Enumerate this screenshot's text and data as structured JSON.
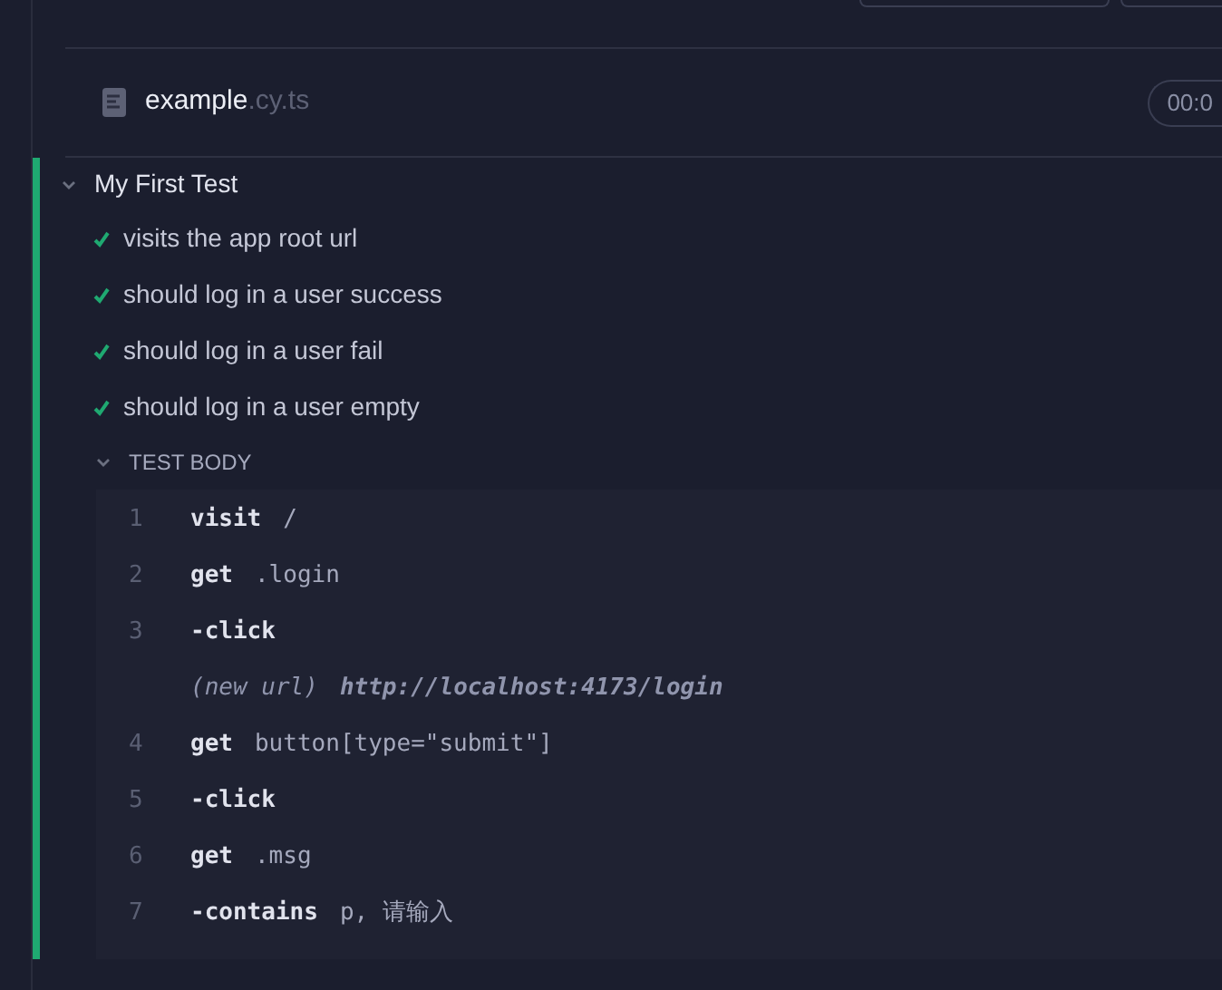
{
  "spec": {
    "name": "example",
    "extension": ".cy.ts",
    "duration": "00:0"
  },
  "suite": {
    "title": "My First Test",
    "expanded": true,
    "tests": [
      {
        "title": "visits the app root url",
        "passed": true
      },
      {
        "title": "should log in a user success",
        "passed": true
      },
      {
        "title": "should log in a user fail",
        "passed": true
      },
      {
        "title": "should log in a user empty",
        "passed": true
      }
    ],
    "test_body": {
      "label": "TEST BODY",
      "expanded": true,
      "commands": [
        {
          "kind": "command",
          "number": "1",
          "name": "visit",
          "message": "/"
        },
        {
          "kind": "command",
          "number": "2",
          "name": "get",
          "message": ".login"
        },
        {
          "kind": "child",
          "number": "3",
          "name": "-click"
        },
        {
          "kind": "event",
          "name": "(new url)",
          "message": "http://localhost:4173/login"
        },
        {
          "kind": "command",
          "number": "4",
          "name": "get",
          "message": "button[type=\"submit\"]"
        },
        {
          "kind": "child",
          "number": "5",
          "name": "-click"
        },
        {
          "kind": "command",
          "number": "6",
          "name": "get",
          "message": ".msg"
        },
        {
          "kind": "child",
          "number": "7",
          "name": "-contains",
          "message": "p, 请输入"
        }
      ]
    }
  }
}
